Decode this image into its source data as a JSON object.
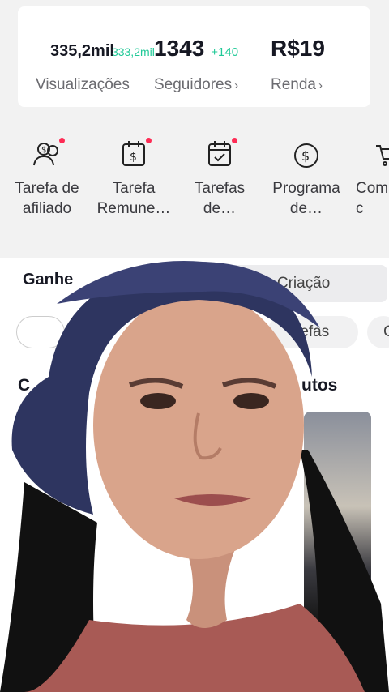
{
  "stats": {
    "views": {
      "value": "335,2mil",
      "delta": "333,2mil",
      "label": "Visualizações"
    },
    "followers": {
      "value": "1343",
      "delta": "+140",
      "label": "Seguidores",
      "chevron": "›"
    },
    "income": {
      "value": "R$19",
      "label": "Renda",
      "chevron": "›"
    }
  },
  "tools": [
    {
      "label": "Tarefa de\nafiliado",
      "icon": "affiliate-icon",
      "badge": true
    },
    {
      "label": "Tarefa\nRemune…",
      "icon": "dollar-calendar-icon",
      "badge": true
    },
    {
      "label": "Tarefas\nde…",
      "icon": "check-calendar-icon",
      "badge": true
    },
    {
      "label": "Programa\nde…",
      "icon": "dollar-circle-icon",
      "badge": false
    },
    {
      "label": "Com\nc",
      "icon": "cart-icon",
      "badge": false
    }
  ],
  "tabs": {
    "active": "Ganhe",
    "other": "lhorar Criação"
  },
  "chips": [
    "",
    "refas",
    "C"
  ],
  "section": {
    "title_left": "C",
    "title_right": "utos"
  },
  "colors": {
    "badge": "#fe2c55",
    "delta": "#20c997"
  }
}
